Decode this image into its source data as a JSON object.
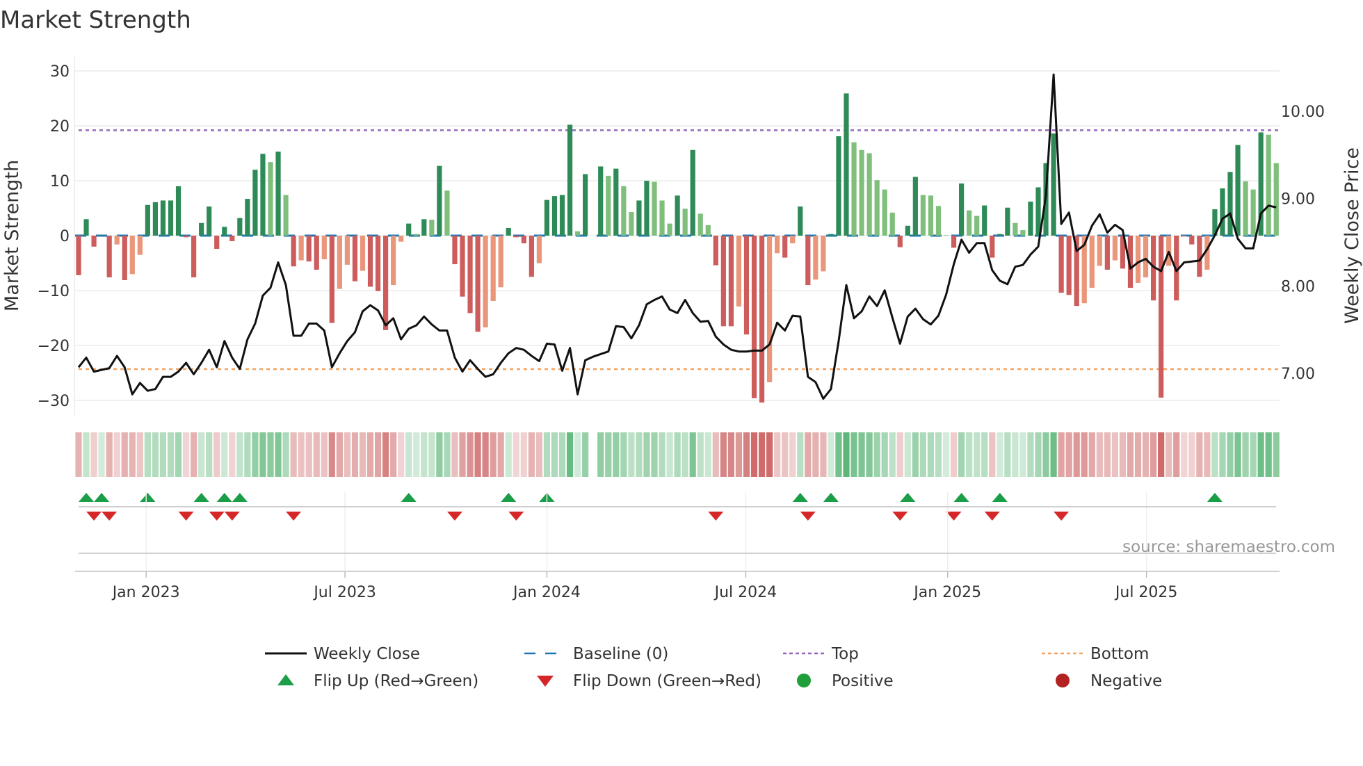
{
  "title": "Market Strength",
  "source": "source: sharemaestro.com",
  "colors": {
    "pos_strong": "#2e8b57",
    "pos_weak": "#7fbf7b",
    "neg_strong": "#cd5c5c",
    "neg_weak": "#e9967a",
    "line": "#111111",
    "baseline": "#1f77b4",
    "top": "#9467bd",
    "bottom": "#f4a460",
    "flip_up": "#1a9e47",
    "flip_down": "#d62728",
    "positive": "#1f9e3a",
    "negative": "#b22222"
  },
  "chart_data": {
    "type": "bar",
    "title": "Market Strength",
    "ylabel": "Market Strength",
    "y2label": "Weekly Close Price",
    "ylim": [
      -32.8,
      32.7
    ],
    "y2lim": [
      6.52,
      10.63
    ],
    "y_ticks": [
      "30",
      "20",
      "10",
      "0",
      "−10",
      "−20",
      "−30"
    ],
    "y_tick_values": [
      30,
      20,
      10,
      0,
      -10,
      -20,
      -30
    ],
    "y2_ticks": [
      "10.00",
      "9.00",
      "8.00",
      "7.00"
    ],
    "y2_tick_values": [
      10,
      9,
      8,
      7
    ],
    "top_level": 19.2,
    "bottom_level": -24.3,
    "x_ticks": [
      {
        "label": "Jan 2023",
        "week_index": 8.8
      },
      {
        "label": "Jul 2023",
        "week_index": 34.7
      },
      {
        "label": "Jan 2024",
        "week_index": 61
      },
      {
        "label": "Jul 2024",
        "week_index": 86.9
      },
      {
        "label": "Jan 2025",
        "week_index": 113.2
      },
      {
        "label": "Jul 2025",
        "week_index": 139.1
      }
    ],
    "strength": [
      -7.2,
      3.0,
      -2.0,
      0.1,
      -7.6,
      -1.6,
      -8.1,
      -7.0,
      -3.5,
      5.6,
      6.1,
      6.4,
      6.4,
      9.0,
      -0.3,
      -7.6,
      2.3,
      5.3,
      -2.4,
      1.6,
      -1.0,
      3.2,
      6.7,
      12.0,
      14.9,
      13.4,
      15.3,
      7.4,
      -5.6,
      -4.5,
      -4.7,
      -6.2,
      -4.3,
      -15.9,
      -9.7,
      -5.3,
      -8.3,
      -6.4,
      -9.3,
      -10.1,
      -17.2,
      -9.0,
      -1.1,
      2.2,
      0.3,
      3.0,
      2.9,
      12.7,
      8.2,
      -5.2,
      -11.1,
      -14.1,
      -17.5,
      -16.7,
      -11.9,
      -9.4,
      1.4,
      -0.3,
      -1.4,
      -7.5,
      -5.0,
      6.5,
      7.2,
      7.4,
      20.2,
      0.8,
      11.2,
      0,
      12.6,
      10.9,
      12.2,
      9.0,
      4.3,
      6.4,
      10.0,
      9.8,
      6.4,
      2.2,
      7.3,
      4.9,
      15.6,
      4.0,
      1.9,
      -5.4,
      -16.5,
      -16.5,
      -12.9,
      -18.0,
      -29.6,
      -30.4,
      -26.7,
      -3.2,
      -4.0,
      -1.4,
      5.3,
      -9.0,
      -8.0,
      -6.5,
      0.3,
      18.1,
      25.9,
      17.0,
      15.6,
      15.0,
      10.1,
      8.4,
      4.2,
      -2.1,
      1.8,
      10.7,
      7.4,
      7.3,
      5.4,
      0.1,
      -2.2,
      9.5,
      4.6,
      3.6,
      5.5,
      -4.0,
      0.3,
      5.1,
      2.3,
      1.0,
      6.2,
      8.8,
      13.2,
      18.6,
      -10.4,
      -10.8,
      -12.8,
      -12.3,
      -9.5,
      -5.5,
      -6.2,
      -4.5,
      -6.0,
      -9.5,
      -8.6,
      -7.6,
      -11.8,
      -29.5,
      -5.5,
      -11.8,
      -0.2,
      -1.6,
      -7.5,
      -6.2,
      4.8,
      8.6,
      11.6,
      16.5,
      9.9,
      8.4,
      18.8,
      18.4,
      13.2
    ],
    "weekly_close": [
      7.07,
      7.18,
      7.02,
      7.04,
      7.06,
      7.2,
      7.07,
      6.76,
      6.89,
      6.8,
      6.82,
      6.96,
      6.96,
      7.02,
      7.12,
      6.99,
      7.12,
      7.27,
      7.07,
      7.37,
      7.18,
      7.05,
      7.39,
      7.57,
      7.89,
      7.98,
      8.27,
      8.01,
      7.43,
      7.43,
      7.57,
      7.57,
      7.49,
      7.07,
      7.23,
      7.37,
      7.47,
      7.71,
      7.78,
      7.72,
      7.55,
      7.63,
      7.39,
      7.51,
      7.55,
      7.65,
      7.56,
      7.49,
      7.49,
      7.18,
      7.02,
      7.15,
      7.05,
      6.96,
      6.99,
      7.12,
      7.23,
      7.29,
      7.27,
      7.2,
      7.14,
      7.34,
      7.33,
      7.03,
      7.29,
      6.76,
      7.15,
      7.19,
      7.22,
      7.25,
      7.54,
      7.53,
      7.4,
      7.55,
      7.79,
      7.84,
      7.88,
      7.73,
      7.69,
      7.84,
      7.69,
      7.59,
      7.6,
      7.42,
      7.33,
      7.27,
      7.25,
      7.25,
      7.26,
      7.26,
      7.33,
      7.58,
      7.49,
      7.66,
      7.65,
      6.96,
      6.9,
      6.71,
      6.82,
      7.37,
      8.01,
      7.63,
      7.71,
      7.88,
      7.77,
      7.95,
      7.64,
      7.34,
      7.65,
      7.74,
      7.62,
      7.56,
      7.66,
      7.9,
      8.25,
      8.53,
      8.38,
      8.49,
      8.49,
      8.18,
      8.06,
      8.02,
      8.22,
      8.24,
      8.36,
      8.45,
      9.03,
      10.42,
      8.71,
      8.84,
      8.4,
      8.47,
      8.69,
      8.82,
      8.61,
      8.7,
      8.64,
      8.2,
      8.27,
      8.31,
      8.22,
      8.17,
      8.39,
      8.17,
      8.27,
      8.28,
      8.29,
      8.42,
      8.58,
      8.77,
      8.83,
      8.54,
      8.43,
      8.43,
      8.83,
      8.92,
      8.9
    ],
    "legend": {
      "placement": "bottom",
      "items": [
        {
          "label": "Weekly Close",
          "kind": "line"
        },
        {
          "label": "Baseline (0)",
          "kind": "dash"
        },
        {
          "label": "Top",
          "kind": "dot-top"
        },
        {
          "label": "Bottom",
          "kind": "dot-bottom"
        },
        {
          "label": "Flip Up (Red→Green)",
          "kind": "tri-up"
        },
        {
          "label": "Flip Down (Green→Red)",
          "kind": "tri-down"
        },
        {
          "label": "Positive",
          "kind": "circle-pos"
        },
        {
          "label": "Negative",
          "kind": "circle-neg"
        }
      ]
    }
  }
}
